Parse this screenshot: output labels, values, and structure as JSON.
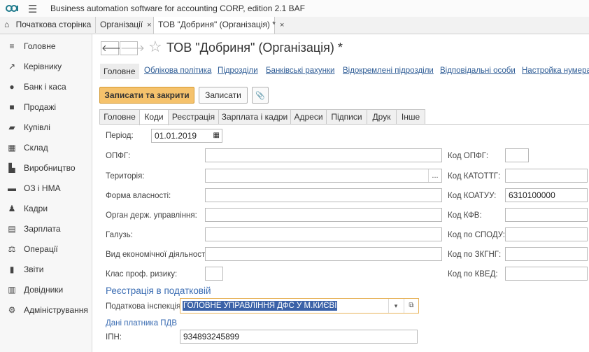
{
  "window": {
    "title": "Business automation software for accounting CORP, edition 2.1 BAF",
    "logo_icon": "1c-logo-icon",
    "menu_icon": "hamburger-icon"
  },
  "tabs": [
    {
      "label": "Початкова сторінка",
      "icon": "home-icon"
    },
    {
      "label": "Організації",
      "close": "×"
    },
    {
      "label": "ТОВ \"Добриня\" (Організація) *",
      "close": "×"
    }
  ],
  "sidebar": {
    "items": [
      {
        "label": "Головне",
        "icon": "menu-icon"
      },
      {
        "label": "Керівнику",
        "icon": "trend-icon"
      },
      {
        "label": "Банк і каса",
        "icon": "coin-icon"
      },
      {
        "label": "Продажі",
        "icon": "bag-icon"
      },
      {
        "label": "Купівлі",
        "icon": "cart-icon"
      },
      {
        "label": "Склад",
        "icon": "warehouse-icon"
      },
      {
        "label": "Виробництво",
        "icon": "factory-icon"
      },
      {
        "label": "ОЗ і НМА",
        "icon": "truck-icon"
      },
      {
        "label": "Кадри",
        "icon": "person-icon"
      },
      {
        "label": "Зарплата",
        "icon": "salary-icon"
      },
      {
        "label": "Операції",
        "icon": "scales-icon"
      },
      {
        "label": "Звіти",
        "icon": "bar-chart-icon"
      },
      {
        "label": "Довідники",
        "icon": "books-icon"
      },
      {
        "label": "Адміністрування",
        "icon": "gear-icon"
      }
    ]
  },
  "form": {
    "title": "ТОВ \"Добриня\" (Організація) *",
    "nav": {
      "back": "🡐",
      "forward": "🡒",
      "star": "☆"
    },
    "links": {
      "current": "Головне",
      "items": [
        "Облікова політика",
        "Підрозділи",
        "Банківські рахунки",
        "Відокремлені підрозділи",
        "Відповідальні особи",
        "Настройка нумерації"
      ]
    },
    "buttons": {
      "save_close": "Записати та закрити",
      "save": "Записати",
      "attach_icon": "📎"
    },
    "tabs": [
      "Головне",
      "Коди",
      "Реєстрація",
      "Зарплата і кадри",
      "Адреси",
      "Підписи",
      "Друк",
      "Інше"
    ],
    "active_tab": "Коди",
    "period": {
      "label": "Період:",
      "value": "01.01.2019",
      "icon": "calendar-icon"
    },
    "left_fields": [
      {
        "label": "ОПФГ:",
        "value": ""
      },
      {
        "label": "Територія:",
        "value": "",
        "button": "..."
      },
      {
        "label": "Форма власності:",
        "value": ""
      },
      {
        "label": "Орган держ. управління:",
        "value": ""
      },
      {
        "label": "Галузь:",
        "value": ""
      },
      {
        "label": "Вид економічної діяльності:",
        "value": ""
      },
      {
        "label": "Клас проф. ризику:",
        "value": ""
      }
    ],
    "right_fields": [
      {
        "label": "Код ОПФГ:",
        "value": ""
      },
      {
        "label": "Код КАТОТТГ:",
        "value": ""
      },
      {
        "label": "Код КОАТУУ:",
        "value": "6310100000"
      },
      {
        "label": "Код КФВ:",
        "value": ""
      },
      {
        "label": "Код по СПОДУ:",
        "value": ""
      },
      {
        "label": "Код по ЗКГНГ:",
        "value": ""
      },
      {
        "label": "Код по КВЕД:",
        "value": ""
      }
    ],
    "tax_section": {
      "title": "Реєстрація в податковій",
      "inspection_label": "Податкова інспекція:",
      "inspection_value": "ГОЛОВНЕ УПРАВЛІННЯ ДФС У М.КИЄВІ",
      "dropdown_icon": "▾",
      "open_icon": "⧉",
      "vat_title": "Дані платника ПДВ",
      "ipn_label": "ІПН:",
      "ipn_value": "934893245899"
    }
  }
}
